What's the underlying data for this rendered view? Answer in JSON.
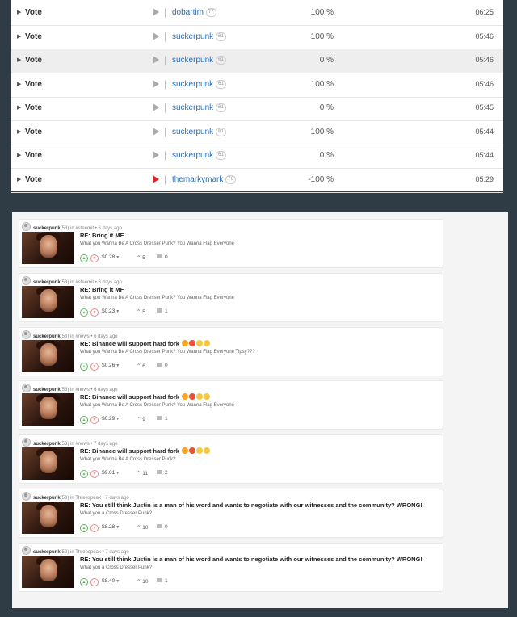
{
  "votes": [
    {
      "label": "Vote",
      "voter": "dobartim",
      "rep": "77",
      "percent": "100 %",
      "time": "06:25",
      "flag": false
    },
    {
      "label": "Vote",
      "voter": "suckerpunk",
      "rep": "61",
      "percent": "100 %",
      "time": "05:46",
      "flag": false
    },
    {
      "label": "Vote",
      "voter": "suckerpunk",
      "rep": "61",
      "percent": "0 %",
      "time": "05:46",
      "flag": false
    },
    {
      "label": "Vote",
      "voter": "suckerpunk",
      "rep": "61",
      "percent": "100 %",
      "time": "05:46",
      "flag": false
    },
    {
      "label": "Vote",
      "voter": "suckerpunk",
      "rep": "61",
      "percent": "0 %",
      "time": "05:45",
      "flag": false
    },
    {
      "label": "Vote",
      "voter": "suckerpunk",
      "rep": "61",
      "percent": "100 %",
      "time": "05:44",
      "flag": false
    },
    {
      "label": "Vote",
      "voter": "suckerpunk",
      "rep": "61",
      "percent": "0 %",
      "time": "05:44",
      "flag": false
    },
    {
      "label": "Vote",
      "voter": "themarkymark",
      "rep": "78",
      "percent": "-100 %",
      "time": "05:29",
      "flag": true
    }
  ],
  "posts": [
    {
      "author": "suckerpunk",
      "rep": "(53)",
      "community": "in #steemit",
      "age": "6 days ago",
      "title": "RE: Bring it MF",
      "emojis": [],
      "body": "What you Wanna Be A Cross Dresser Punk? You Wanna Flag Everyone",
      "payout": "$0.28",
      "votes": "5",
      "comments": "0"
    },
    {
      "author": "suckerpunk",
      "rep": "(53)",
      "community": "in #steemit",
      "age": "6 days ago",
      "title": "RE: Bring it MF",
      "emojis": [],
      "body": "What you Wanna Be A Cross Dresser Punk? You Wanna Flag Everyone",
      "payout": "$0.23",
      "votes": "5",
      "comments": "1"
    },
    {
      "author": "suckerpunk",
      "rep": "(53)",
      "community": "in #news",
      "age": "6 days ago",
      "title": "RE: Binance will support hard fork",
      "emojis": [
        "#f5a623",
        "#e55039",
        "#f5c842",
        "#f5c842"
      ],
      "body": "What you Wanna Be A Cross Dresser Punk? You Wanna Flag Everyone Tipsy???",
      "payout": "$0.26",
      "votes": "6",
      "comments": "0"
    },
    {
      "author": "suckerpunk",
      "rep": "(53)",
      "community": "in #news",
      "age": "6 days ago",
      "title": "RE: Binance will support hard fork",
      "emojis": [
        "#f5a623",
        "#e55039",
        "#f5c842",
        "#f5c842"
      ],
      "body": "What you Wanna Be A Cross Dresser Punk? You Wanna Flag Everyone",
      "payout": "$0.29",
      "votes": "9",
      "comments": "1"
    },
    {
      "author": "suckerpunk",
      "rep": "(53)",
      "community": "in #news",
      "age": "7 days ago",
      "title": "RE: Binance will support hard fork",
      "emojis": [
        "#f5a623",
        "#e55039",
        "#f5c842",
        "#f5c842"
      ],
      "body": "What you Wanna Be A Cross Dresser Punk?",
      "payout": "$9.01",
      "votes": "11",
      "comments": "2"
    },
    {
      "author": "suckerpunk",
      "rep": "(53)",
      "community": "in Threespeak",
      "age": "7 days ago",
      "title": "RE: You still think Justin is a man of his word and wants to negotiate with our witnesses and the community? WRONG!",
      "emojis": [],
      "body": "What you a Cross Dresser Punk?",
      "payout": "$8.28",
      "votes": "10",
      "comments": "0"
    },
    {
      "author": "suckerpunk",
      "rep": "(53)",
      "community": "in Threespeak",
      "age": "7 days ago",
      "title": "RE: You still think Justin is a man of his word and wants to negotiate with our witnesses and the community? WRONG!",
      "emojis": [],
      "body": "What you a Cross Dresser Punk?",
      "payout": "$8.40",
      "votes": "10",
      "comments": "1"
    }
  ]
}
